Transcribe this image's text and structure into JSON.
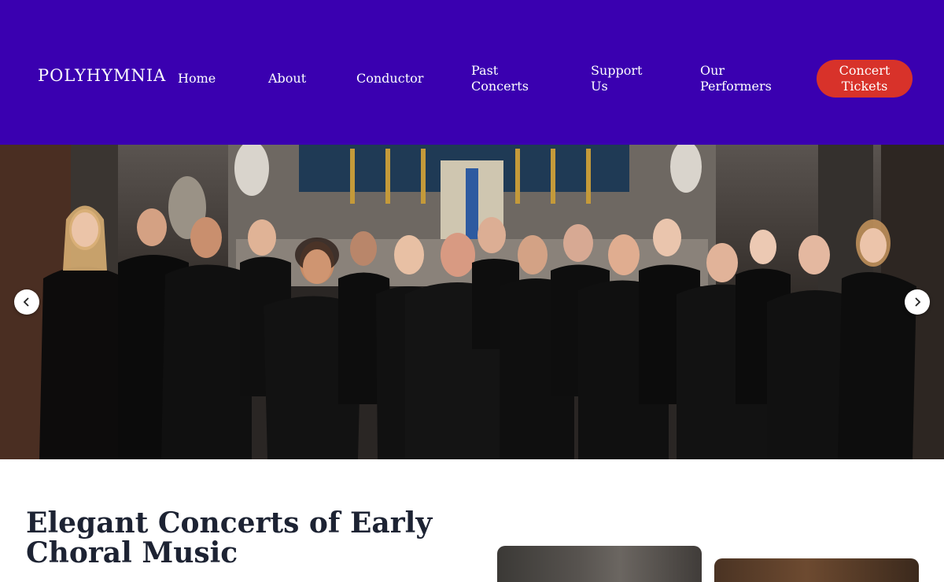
{
  "header": {
    "logo": "POLYHYMNIA",
    "nav": [
      {
        "label": "Home"
      },
      {
        "label": "About"
      },
      {
        "label": "Conductor"
      },
      {
        "label": "Past\nConcerts"
      },
      {
        "label": "Support\nUs"
      },
      {
        "label": "Our\nPerformers"
      }
    ],
    "cta_label": "Concert\nTickets"
  },
  "hero": {
    "prev_icon": "chevron-left-icon",
    "next_icon": "chevron-right-icon"
  },
  "main": {
    "headline": "Elegant Concerts of Early Choral Music"
  },
  "colors": {
    "header_bg": "#3a00b0",
    "cta_bg": "#d8322a",
    "headline": "#1d2333"
  }
}
